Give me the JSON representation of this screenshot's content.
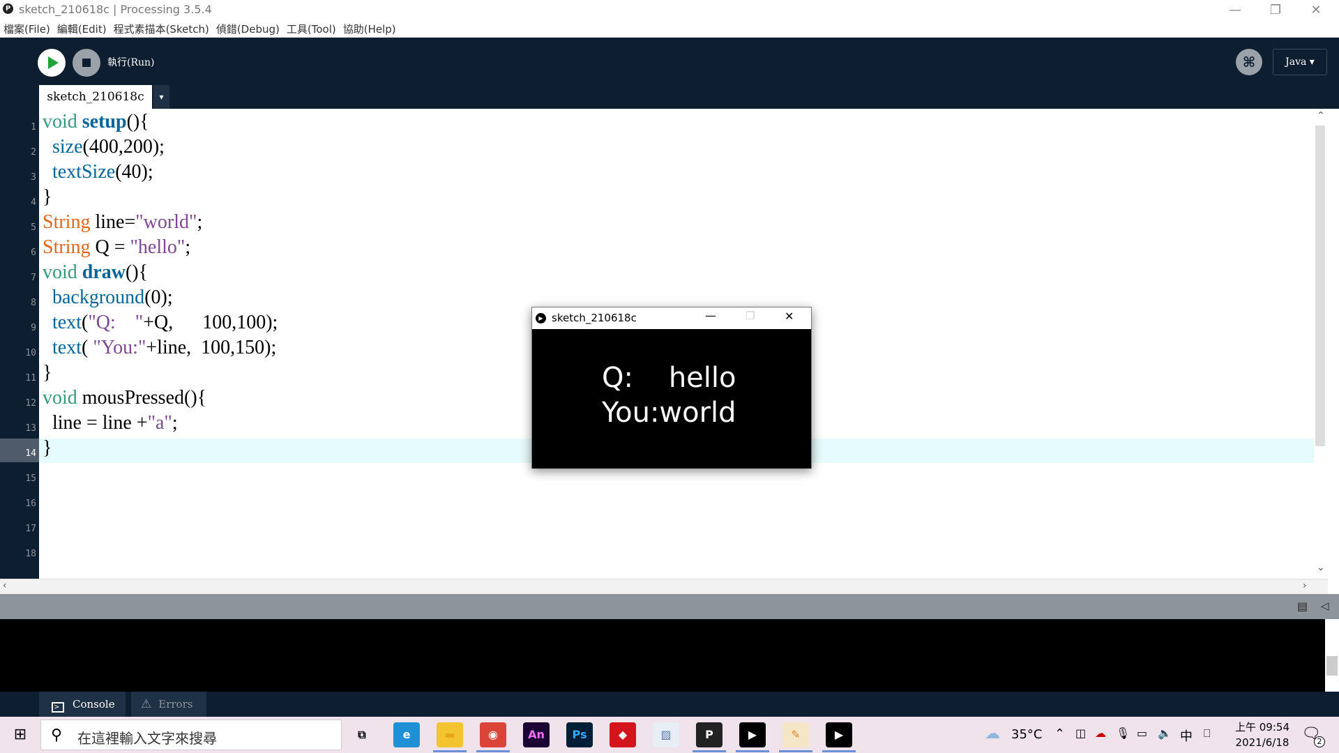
{
  "window": {
    "title": "sketch_210618c | Processing 3.5.4",
    "minimize": "—",
    "maximize": "❐",
    "close": "✕"
  },
  "menu": [
    "檔案(File)",
    "編輯(Edit)",
    "程式素描本(Sketch)",
    "偵錯(Debug)",
    "工具(Tool)",
    "協助(Help)"
  ],
  "toolbar": {
    "run_label": "執行(Run)",
    "mode": "Java ▾",
    "debug_glyph": "⌘"
  },
  "tab": {
    "name": "sketch_210618c",
    "menu_glyph": "▾"
  },
  "line_numbers": [
    "1",
    "2",
    "3",
    "4",
    "5",
    "6",
    "7",
    "8",
    "9",
    "10",
    "11",
    "12",
    "13",
    "14",
    "15",
    "16",
    "17",
    "18"
  ],
  "code": {
    "l1": {
      "a": "void",
      "b": " ",
      "c": "setup",
      "d": "(){"
    },
    "l2": {
      "a": "  ",
      "b": "size",
      "c": "(400,200);"
    },
    "l3": {
      "a": "  ",
      "b": "textSize",
      "c": "(40);"
    },
    "l4": "}",
    "l5": {
      "a": "String",
      "b": " line=",
      "c": "\"world\"",
      "d": ";"
    },
    "l6": {
      "a": "String",
      "b": " Q = ",
      "c": "\"hello\"",
      "d": ";"
    },
    "l7": {
      "a": "void",
      "b": " ",
      "c": "draw",
      "d": "(){"
    },
    "l8": {
      "a": "  ",
      "b": "background",
      "c": "(0);"
    },
    "l9": {
      "a": "  ",
      "b": "text",
      "c": "(",
      "d": "\"Q:    \"",
      "e": "+Q,      100,100);"
    },
    "l10": {
      "a": "  ",
      "b": "text",
      "c": "( ",
      "d": "\"You:\"",
      "e": "+line,  100,150);"
    },
    "l11": "}",
    "l12": {
      "a": "void",
      "b": " mousPressed(){"
    },
    "l13": {
      "a": "  line = line +",
      "b": "\"a\"",
      "c": ";"
    },
    "l14": "}"
  },
  "sketch_window": {
    "title": "sketch_210618c",
    "line1": "Q:    hello",
    "line2": "You:world"
  },
  "console": {
    "console_tab": "Console",
    "errors_tab": "Errors"
  },
  "taskbar": {
    "search_placeholder": "在這裡輸入文字來搜尋",
    "weather": "35°C",
    "ime": "中",
    "time": "上午 09:54",
    "date": "2021/6/18",
    "notification_count": "2",
    "apps": [
      {
        "name": "task-view",
        "glyph": "⧉",
        "color": "#000000",
        "bg": "transparent"
      },
      {
        "name": "edge",
        "glyph": "e",
        "color": "#ffffff",
        "bg": "#1f8fd6"
      },
      {
        "name": "file-explorer",
        "glyph": "▬",
        "color": "#e6a817",
        "bg": "#f4c430"
      },
      {
        "name": "chrome",
        "glyph": "◉",
        "color": "#ffffff",
        "bg": "#db4437"
      },
      {
        "name": "animate",
        "glyph": "An",
        "color": "#ff6cff",
        "bg": "#1a0533"
      },
      {
        "name": "photoshop",
        "glyph": "Ps",
        "color": "#31a8ff",
        "bg": "#001e36"
      },
      {
        "name": "garena",
        "glyph": "◆",
        "color": "#ffffff",
        "bg": "#d4141c"
      },
      {
        "name": "photos",
        "glyph": "▨",
        "color": "#5a7da8",
        "bg": "#e8eef6"
      },
      {
        "name": "processing",
        "glyph": "P",
        "color": "#ffffff",
        "bg": "#222222"
      },
      {
        "name": "sketch-run",
        "glyph": "▶",
        "color": "#ffffff",
        "bg": "#000000"
      },
      {
        "name": "paint",
        "glyph": "✎",
        "color": "#d98a2b",
        "bg": "#f6e6c8"
      },
      {
        "name": "sketch-run-2",
        "glyph": "▶",
        "color": "#ffffff",
        "bg": "#000000"
      }
    ]
  }
}
